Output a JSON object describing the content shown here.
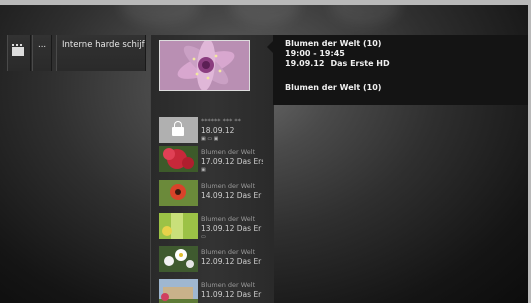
{
  "breadcrumb": {
    "ellipsis": "...",
    "folder": "Interne harde schijf"
  },
  "recordings": {
    "preview_image": "pink-flower-closeup",
    "items": [
      {
        "title": "****** *** **",
        "date": "18.09.12",
        "locked": true
      },
      {
        "title": "Blumen der Welt",
        "date": "17.09.12 Das Ers",
        "thumb": "red-flower"
      },
      {
        "title": "Blumen der Welt",
        "date": "14.09.12 Das Er",
        "thumb": "red-poppy"
      },
      {
        "title": "Blumen der Welt",
        "date": "13.09.12 Das Er",
        "thumb": "green-garden"
      },
      {
        "title": "Blumen der Welt",
        "date": "12.09.12 Das Er",
        "thumb": "white-flowers"
      },
      {
        "title": "Blumen der Welt",
        "date": "11.09.12 Das Er",
        "thumb": "garden-building"
      }
    ]
  },
  "info": {
    "title": "Blumen der Welt (10)",
    "time": "19:00 - 19:45",
    "date": "19.09.12",
    "channel": "Das Erste HD",
    "episode": "Blumen der Welt (10)"
  },
  "colors": {
    "background_center": "#6a6a6a",
    "background_edge": "#0c0c0c",
    "panel": "#141414"
  }
}
